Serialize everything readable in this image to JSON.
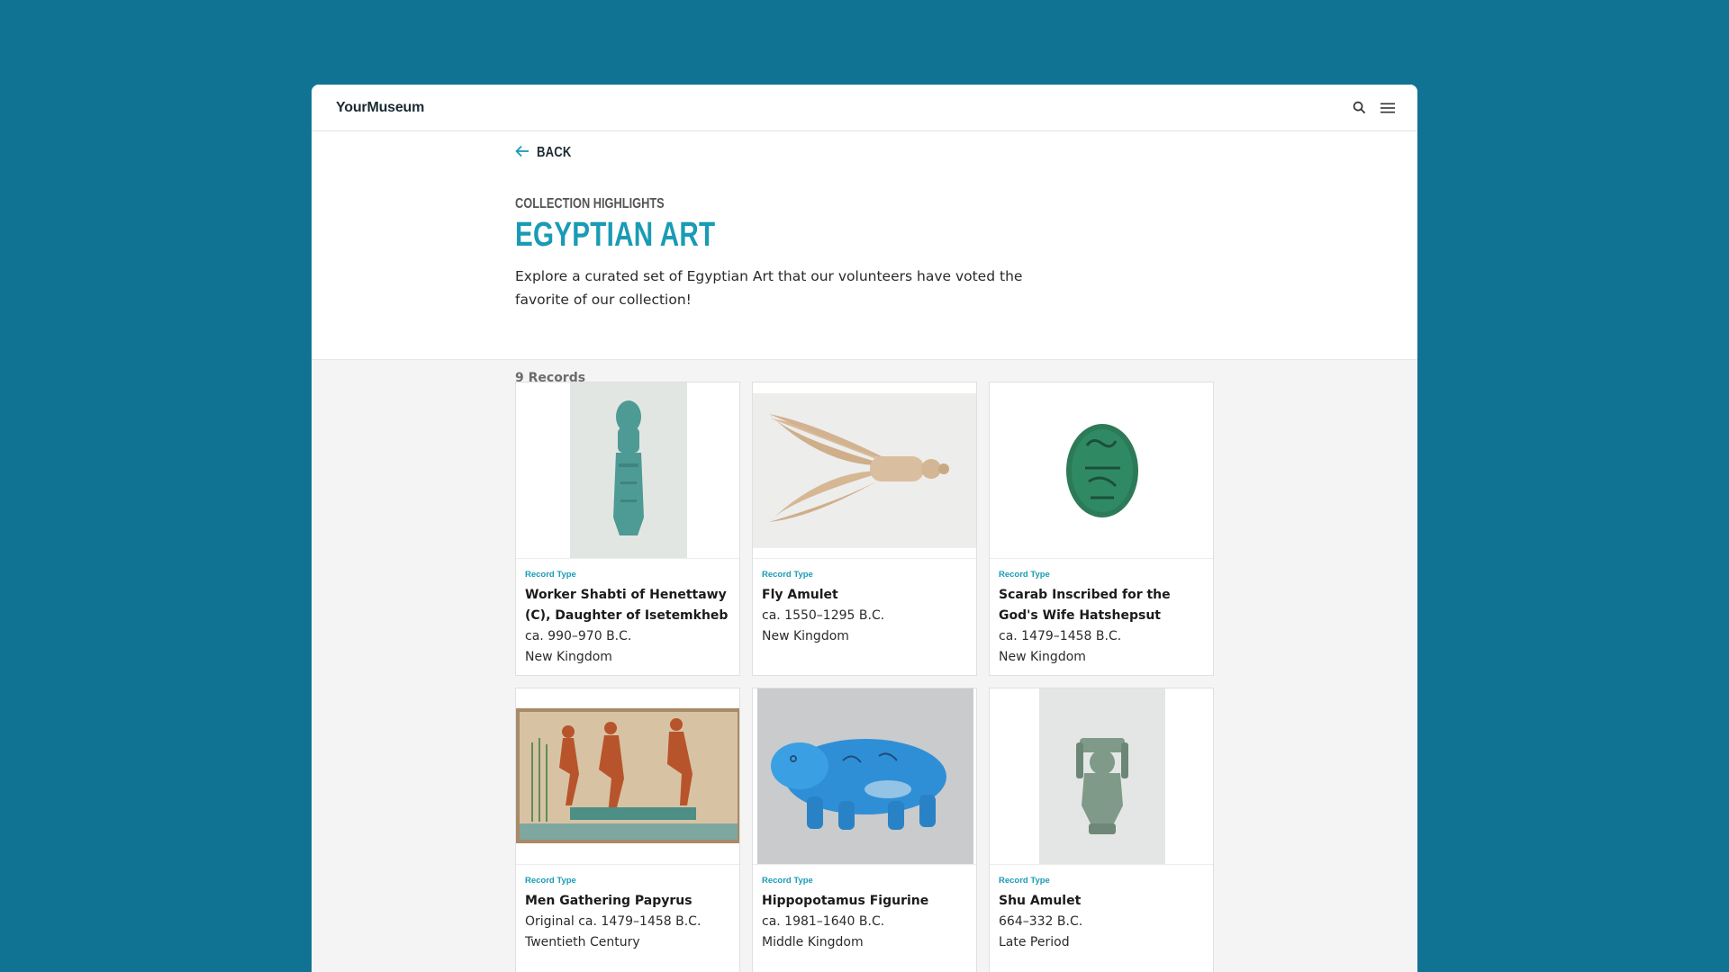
{
  "header": {
    "brand": "YourMuseum",
    "search_icon": "search-icon",
    "menu_icon": "menu-icon"
  },
  "back": {
    "label": "BACK"
  },
  "hero": {
    "eyebrow": "COLLECTION HIGHLIGHTS",
    "title": "EGYPTIAN ART",
    "description": "Explore a curated set of Egyptian Art that our volunteers have voted the favorite of our collection!",
    "records": "9 Records"
  },
  "colors": {
    "accent": "#1a9bb5",
    "background": "#117393"
  },
  "cards": [
    {
      "type": "Record Type",
      "title": "Worker Shabti of Henettawy (C), Daughter of Isetemkheb",
      "date": "ca. 990–970 B.C.",
      "period": "New Kingdom",
      "image": "shabti-figurine"
    },
    {
      "type": "Record Type",
      "title": "Fly Amulet",
      "date": "ca. 1550–1295 B.C.",
      "period": "New Kingdom",
      "image": "fly-amulet"
    },
    {
      "type": "Record Type",
      "title": "Scarab Inscribed for the God's Wife Hatshepsut",
      "date": "ca. 1479–1458 B.C.",
      "period": "New Kingdom",
      "image": "scarab"
    },
    {
      "type": "Record Type",
      "title": "Men Gathering Papyrus",
      "date": "Original ca. 1479–1458 B.C.",
      "period": "Twentieth Century",
      "image": "papyrus-painting"
    },
    {
      "type": "Record Type",
      "title": "Hippopotamus Figurine",
      "date": "ca. 1981–1640 B.C.",
      "period": "Middle Kingdom",
      "image": "hippo-figurine"
    },
    {
      "type": "Record Type",
      "title": "Shu Amulet",
      "date": "664–332 B.C.",
      "period": "Late Period",
      "image": "shu-amulet"
    }
  ]
}
